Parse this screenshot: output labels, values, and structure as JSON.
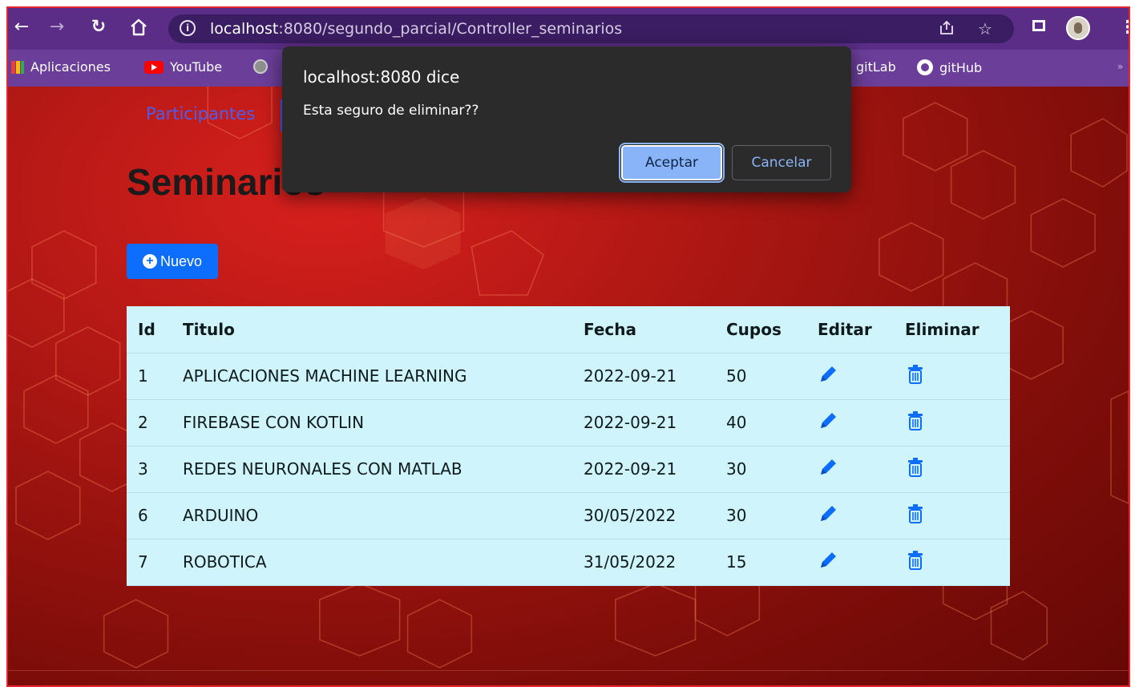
{
  "browser": {
    "url_host": "localhost",
    "url_rest": ":8080/segundo_parcial/Controller_seminarios",
    "icons": [
      "back-arrow-icon",
      "forward-arrow-icon",
      "reload-icon",
      "home-icon",
      "info-icon",
      "share-icon",
      "star-icon",
      "sidepanel-icon",
      "profile-avatar",
      "kebab-menu-icon"
    ]
  },
  "bookmarks": [
    {
      "label": "Aplicaciones",
      "icon": "apps-icon"
    },
    {
      "label": "YouTube",
      "icon": "youtube-icon"
    },
    {
      "label": "gitLab",
      "icon": "gitlab-icon"
    },
    {
      "label": "gitHub",
      "icon": "github-icon"
    }
  ],
  "page": {
    "nav_link": "Participantes",
    "heading": "Seminarios",
    "new_button": "Nuevo"
  },
  "table": {
    "headers": [
      "Id",
      "Titulo",
      "Fecha",
      "Cupos",
      "Editar",
      "Eliminar"
    ],
    "rows": [
      {
        "id": "1",
        "titulo": "APLICACIONES MACHINE LEARNING",
        "fecha": "2022-09-21",
        "cupos": "50"
      },
      {
        "id": "2",
        "titulo": "FIREBASE CON KOTLIN",
        "fecha": "2022-09-21",
        "cupos": "40"
      },
      {
        "id": "3",
        "titulo": "REDES NEURONALES CON MATLAB",
        "fecha": "2022-09-21",
        "cupos": "30"
      },
      {
        "id": "6",
        "titulo": "ARDUINO",
        "fecha": "30/05/2022",
        "cupos": "30"
      },
      {
        "id": "7",
        "titulo": "ROBOTICA",
        "fecha": "31/05/2022",
        "cupos": "15"
      }
    ]
  },
  "dialog": {
    "title": "localhost:8080 dice",
    "message": "Esta seguro de eliminar??",
    "ok": "Aceptar",
    "cancel": "Cancelar"
  },
  "colors": {
    "chrome": "#5b2d86",
    "bookmarks_bar": "#6a3e99",
    "page_bg": "#a81612",
    "table_bg": "#cff4fc",
    "primary": "#0d6efd",
    "dialog_bg": "#2b2b2b",
    "dialog_accent": "#8ab4f8"
  }
}
